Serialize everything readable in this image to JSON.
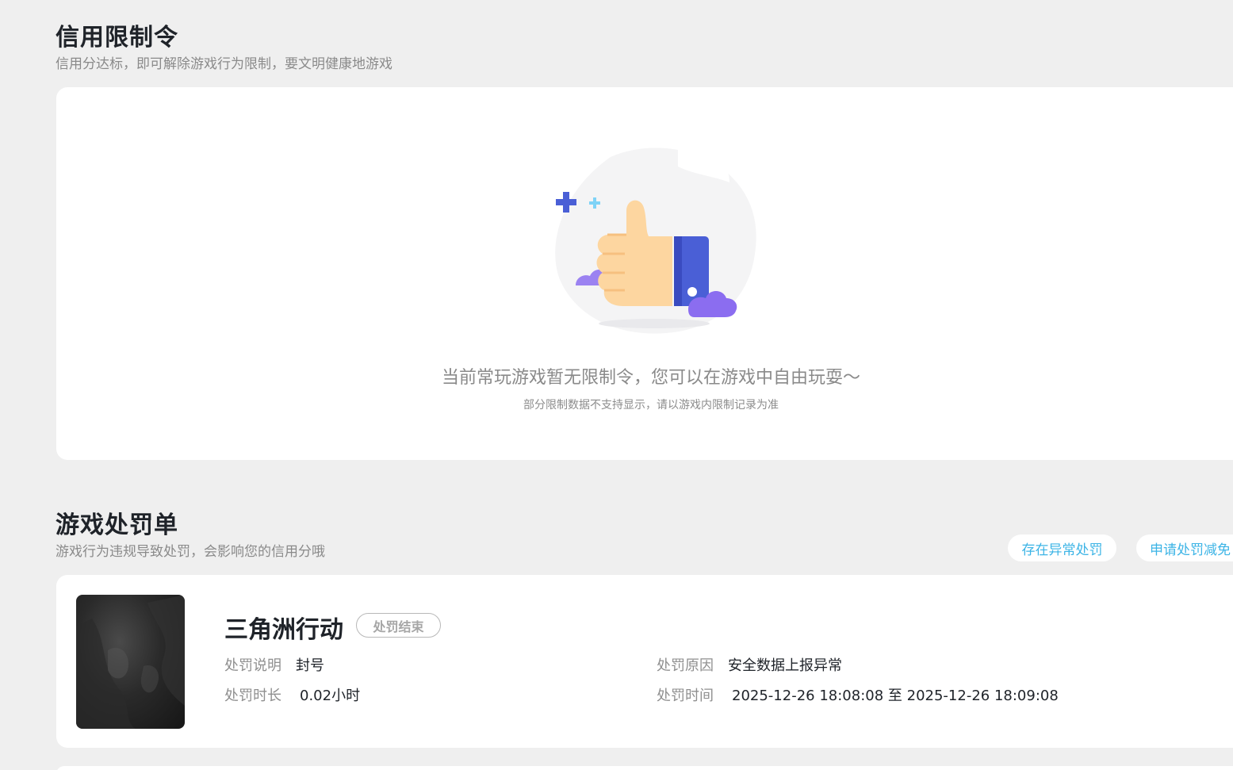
{
  "credit": {
    "title": "信用限制令",
    "subtitle": "信用分达标，即可解除游戏行为限制，要文明健康地游戏",
    "empty_main": "当前常玩游戏暂无限制令，您可以在游戏中自由玩耍～",
    "empty_note": "部分限制数据不支持显示，请以游戏内限制记录为准"
  },
  "penalty": {
    "title": "游戏处罚单",
    "subtitle": "游戏行为违规导致处罚，会影响您的信用分哦",
    "btn_abnormal": "存在异常处罚",
    "btn_appeal": "申请处罚减免"
  },
  "record": {
    "game_name": "三角洲行动",
    "status": "处罚结束",
    "desc_label": "处罚说明",
    "desc_value": "封号",
    "duration_label": "处罚时长",
    "duration_value": "0.02小时",
    "reason_label": "处罚原因",
    "reason_value": "安全数据上报异常",
    "time_label": "处罚时间",
    "time_value": "2025-12-26 18:08:08 至 2025-12-26 18:09:08"
  },
  "colors": {
    "accent": "#3cb4e6",
    "thumb_blue": "#4a5fd6",
    "thumb_skin": "#fdd6a0",
    "cloud_purple": "#8b6df0"
  },
  "icons": {
    "illustration": "thumbs-up-illustration",
    "cover": "game-cover-image"
  }
}
